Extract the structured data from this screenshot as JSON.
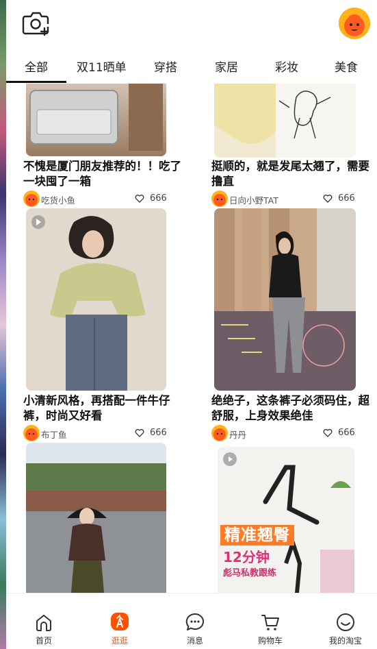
{
  "header": {
    "camera_icon": "camera-add-icon",
    "avatar_icon": "mascot-avatar-icon"
  },
  "tabs": [
    {
      "label": "全部",
      "active": true
    },
    {
      "label": "双11晒单",
      "active": false
    },
    {
      "label": "穿搭",
      "active": false
    },
    {
      "label": "家居",
      "active": false
    },
    {
      "label": "彩妆",
      "active": false
    },
    {
      "label": "美食",
      "active": false
    }
  ],
  "feed": {
    "cards": [
      {
        "title": "不愧是厦门朋友推荐的！！吃了一块囤了一箱",
        "author": "吃货小鱼",
        "likes": "666"
      },
      {
        "title": "挺顺的，就是发尾太翘了，需要撸直",
        "author": "日向小野TAT",
        "likes": "666"
      },
      {
        "title": "小清新风格，再搭配一件牛仔裤，时尚又好看",
        "author": "布丁鱼",
        "likes": "666"
      },
      {
        "title": "绝绝子，这条裤子必须码住，超舒服，上身效果绝佳",
        "author": "丹丹",
        "likes": "666"
      },
      {
        "title": "",
        "author": "",
        "likes": ""
      },
      {
        "title": "",
        "author": "",
        "likes": "",
        "overlay_headline": "精准翘臀",
        "overlay_sub": "12分钟",
        "overlay_caption": "彪马私教跟练"
      }
    ]
  },
  "bottom_nav": [
    {
      "label": "首页",
      "icon": "home-icon",
      "active": false
    },
    {
      "label": "逛逛",
      "icon": "guangguang-icon",
      "active": true
    },
    {
      "label": "消息",
      "icon": "message-icon",
      "active": false
    },
    {
      "label": "购物车",
      "icon": "cart-icon",
      "active": false
    },
    {
      "label": "我的淘宝",
      "icon": "profile-icon",
      "active": false
    }
  ],
  "colors": {
    "accent": "#ff5000",
    "mascot": "#ffb21a"
  }
}
